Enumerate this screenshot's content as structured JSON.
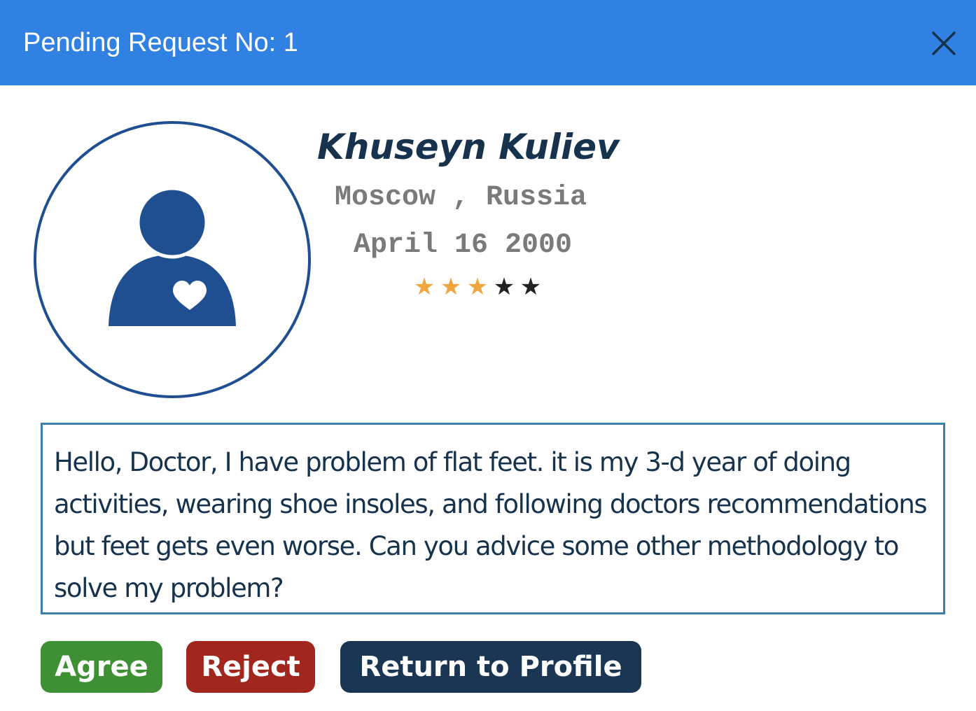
{
  "header": {
    "title": "Pending Request No: 1",
    "close_icon": "close-icon",
    "color": "#3181e2"
  },
  "profile": {
    "avatar_icon": "user-heart-icon",
    "name": "Khuseyn Kuliev",
    "location": "Moscow , Russia",
    "date": "April 16 2000",
    "rating": 3,
    "rating_max": 5,
    "star_filled_color": "#f0a63c",
    "star_empty_color": "#222222"
  },
  "message": {
    "text": "Hello, Doctor, I have problem of flat feet. it is my 3-d year of doing activities, wearing shoe insoles, and following doctors recommendations but feet gets even worse. Can you advice some other methodology to solve my problem?"
  },
  "actions": {
    "agree_label": "Agree",
    "agree_color": "#3f8f35",
    "reject_label": "Reject",
    "reject_color": "#a1261d",
    "profile_label": "Return to Profile",
    "profile_color": "#1b3652"
  }
}
